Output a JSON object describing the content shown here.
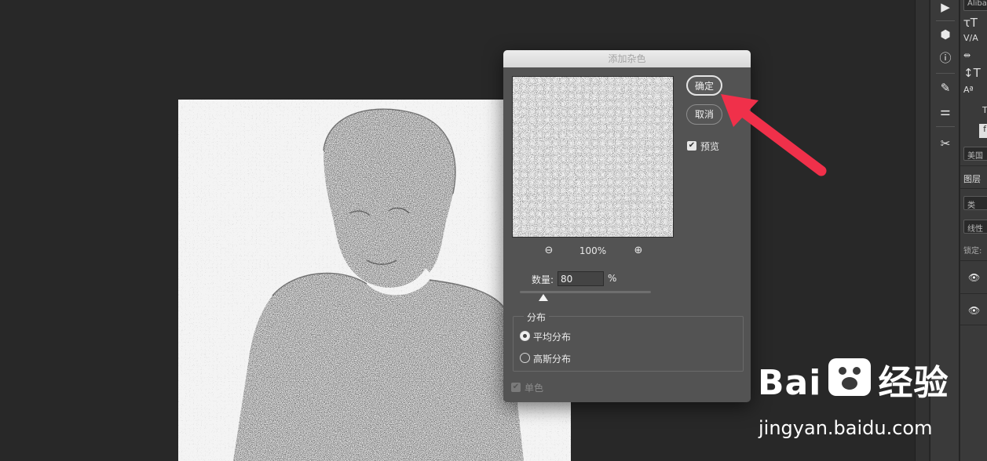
{
  "dialog": {
    "title": "添加杂色",
    "ok_label": "确定",
    "cancel_label": "取消",
    "preview_label": "预览",
    "preview_checked": true,
    "zoom_level": "100%",
    "zoom_out_icon": "zoom-out-icon",
    "zoom_in_icon": "zoom-in-icon",
    "amount_label": "数量:",
    "amount_value": "80",
    "amount_unit": "%",
    "amount_slider_fraction": 0.18,
    "distribution_legend": "分布",
    "distribution_options": [
      "平均分布",
      "高斯分布"
    ],
    "distribution_selected": "平均分布",
    "mono_label": "单色",
    "mono_checked": true,
    "mono_disabled": true
  },
  "right_panel": {
    "font_field": "Aliba",
    "language_field": "美国",
    "layers_tab": "图层",
    "search_placeholder": "类",
    "blend_mode": "线性",
    "lock_label": "锁定:"
  },
  "tool_icons": [
    "play-icon",
    "3d-cube-icon",
    "info-icon",
    "brush-presets-icon",
    "brush-icon",
    "adjustments-icon",
    "tools-icon"
  ],
  "watermark": {
    "brand_text": "Bai",
    "brand_text_2": "经验",
    "url": "jingyan.baidu.com"
  },
  "colors": {
    "arrow": "#f0304a",
    "dialog_bg": "#535353",
    "workspace_bg": "#282828"
  }
}
